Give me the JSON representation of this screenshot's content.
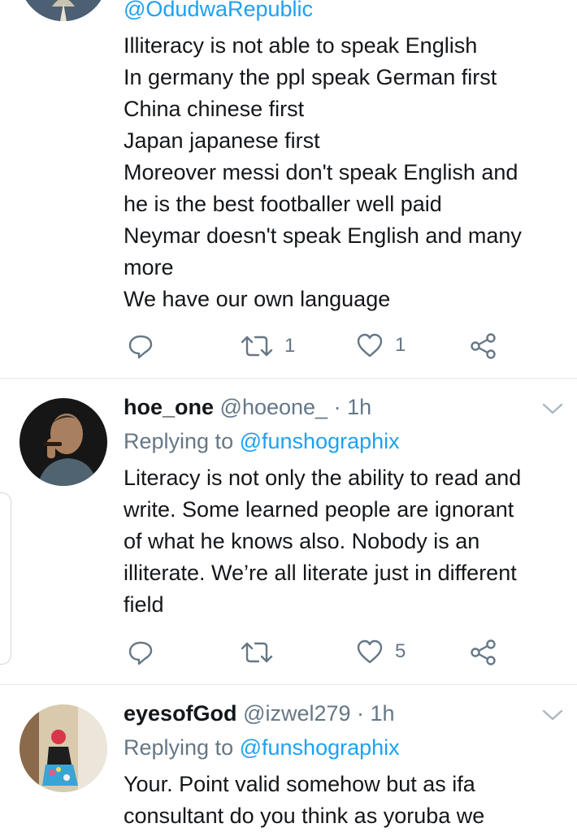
{
  "tweet1": {
    "handle": "@OdudwaRepublic",
    "lines": [
      "Illiteracy is not able to speak English",
      "In germany the ppl speak German first",
      "China chinese first",
      "Japan japanese first",
      "Moreover messi don't speak English and",
      "he is the best footballer well paid",
      "Neymar doesn't speak English and many",
      "more",
      "We have our own language"
    ],
    "retweets": "1",
    "likes": "1"
  },
  "tweet2": {
    "name": "hoe_one",
    "handle": "@hoeone_",
    "time": "· 1h",
    "replying_prefix": "Replying to",
    "replying_to": "@funshographix",
    "lines": [
      "Literacy is not only the ability to read and",
      "write. Some learned people are ignorant",
      "of what he knows also. Nobody is an",
      "illiterate. We’re all literate just in different",
      "field"
    ],
    "retweets": "",
    "likes": "5"
  },
  "tweet3": {
    "name": "eyesofGod",
    "handle": "@izwel279",
    "time": "· 1h",
    "replying_prefix": "Replying to",
    "replying_to": "@funshographix",
    "lines": [
      "Your. Point valid somehow but as ifa",
      "consultant do you think as yoruba we"
    ]
  },
  "icons": {
    "reply": "reply-icon",
    "retweet": "retweet-icon",
    "like": "heart-icon",
    "share": "share-icon",
    "more": "chevron-down-icon"
  },
  "colors": {
    "accent": "#1da1f2",
    "muted": "#657786",
    "text": "#14171a"
  }
}
